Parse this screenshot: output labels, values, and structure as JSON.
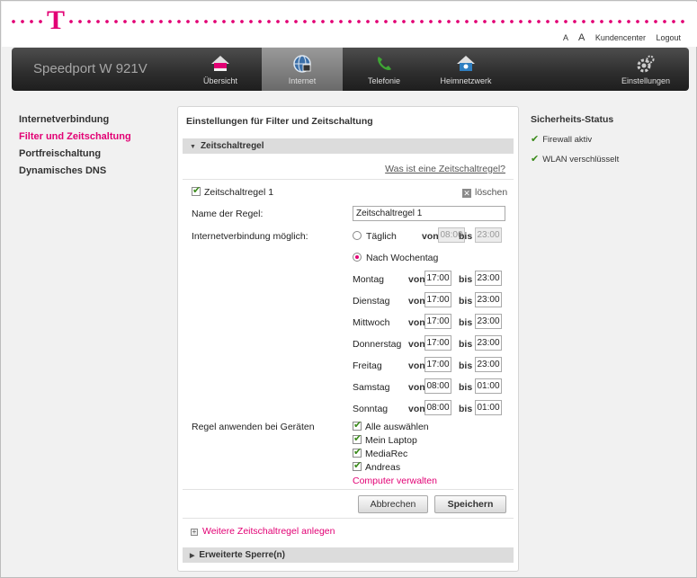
{
  "header": {
    "logo": "T",
    "links": [
      "A",
      "A",
      "Kundencenter",
      "Logout"
    ]
  },
  "nav": {
    "brand": "Speedport W 921V",
    "items": [
      {
        "label": "Übersicht",
        "icon": "home-icon"
      },
      {
        "label": "Internet",
        "icon": "globe-icon"
      },
      {
        "label": "Telefonie",
        "icon": "phone-icon"
      },
      {
        "label": "Heimnetzwerk",
        "icon": "home-network-icon"
      },
      {
        "label": "Einstellungen",
        "icon": "gears-icon"
      }
    ],
    "active": "Internet"
  },
  "sidebar": {
    "items": [
      {
        "label": "Internetverbindung"
      },
      {
        "label": "Filter und Zeitschaltung"
      },
      {
        "label": "Portfreischaltung"
      },
      {
        "label": "Dynamisches DNS"
      }
    ],
    "active": "Filter und Zeitschaltung"
  },
  "panel": {
    "title": "Einstellungen für Filter und Zeitschaltung",
    "section": "Zeitschaltregel",
    "help_link": "Was ist eine Zeitschaltregel?",
    "rule_label": "Zeitschaltregel 1",
    "delete": "löschen",
    "name_label": "Name der Regel:",
    "name_value": "Zeitschaltregel 1",
    "conn_label": "Internetverbindung möglich:",
    "daily": {
      "label": "Täglich",
      "von": "von",
      "from": "08:00",
      "bis": "bis",
      "to": "23:00"
    },
    "weekday_label": "Nach Wochentag",
    "days": [
      {
        "day": "Montag",
        "von": "von",
        "from": "17:00",
        "bis": "bis",
        "to": "23:00"
      },
      {
        "day": "Dienstag",
        "von": "von",
        "from": "17:00",
        "bis": "bis",
        "to": "23:00"
      },
      {
        "day": "Mittwoch",
        "von": "von",
        "from": "17:00",
        "bis": "bis",
        "to": "23:00"
      },
      {
        "day": "Donnerstag",
        "von": "von",
        "from": "17:00",
        "bis": "bis",
        "to": "23:00"
      },
      {
        "day": "Freitag",
        "von": "von",
        "from": "17:00",
        "bis": "bis",
        "to": "23:00"
      },
      {
        "day": "Samstag",
        "von": "von",
        "from": "08:00",
        "bis": "bis",
        "to": "01:00"
      },
      {
        "day": "Sonntag",
        "von": "von",
        "from": "08:00",
        "bis": "bis",
        "to": "01:00"
      }
    ],
    "devices_label": "Regel anwenden bei Geräten",
    "devices": [
      "Alle auswählen",
      "Mein Laptop",
      "MediaRec",
      "Andreas"
    ],
    "manage_link": "Computer verwalten",
    "cancel": "Abbrechen",
    "save": "Speichern",
    "add_rule": "Weitere Zeitschaltregel anlegen",
    "extended": "Erweiterte Sperre(n)"
  },
  "security": {
    "title": "Sicherheits-Status",
    "items": [
      "Firewall aktiv",
      "WLAN verschlüsselt"
    ]
  }
}
